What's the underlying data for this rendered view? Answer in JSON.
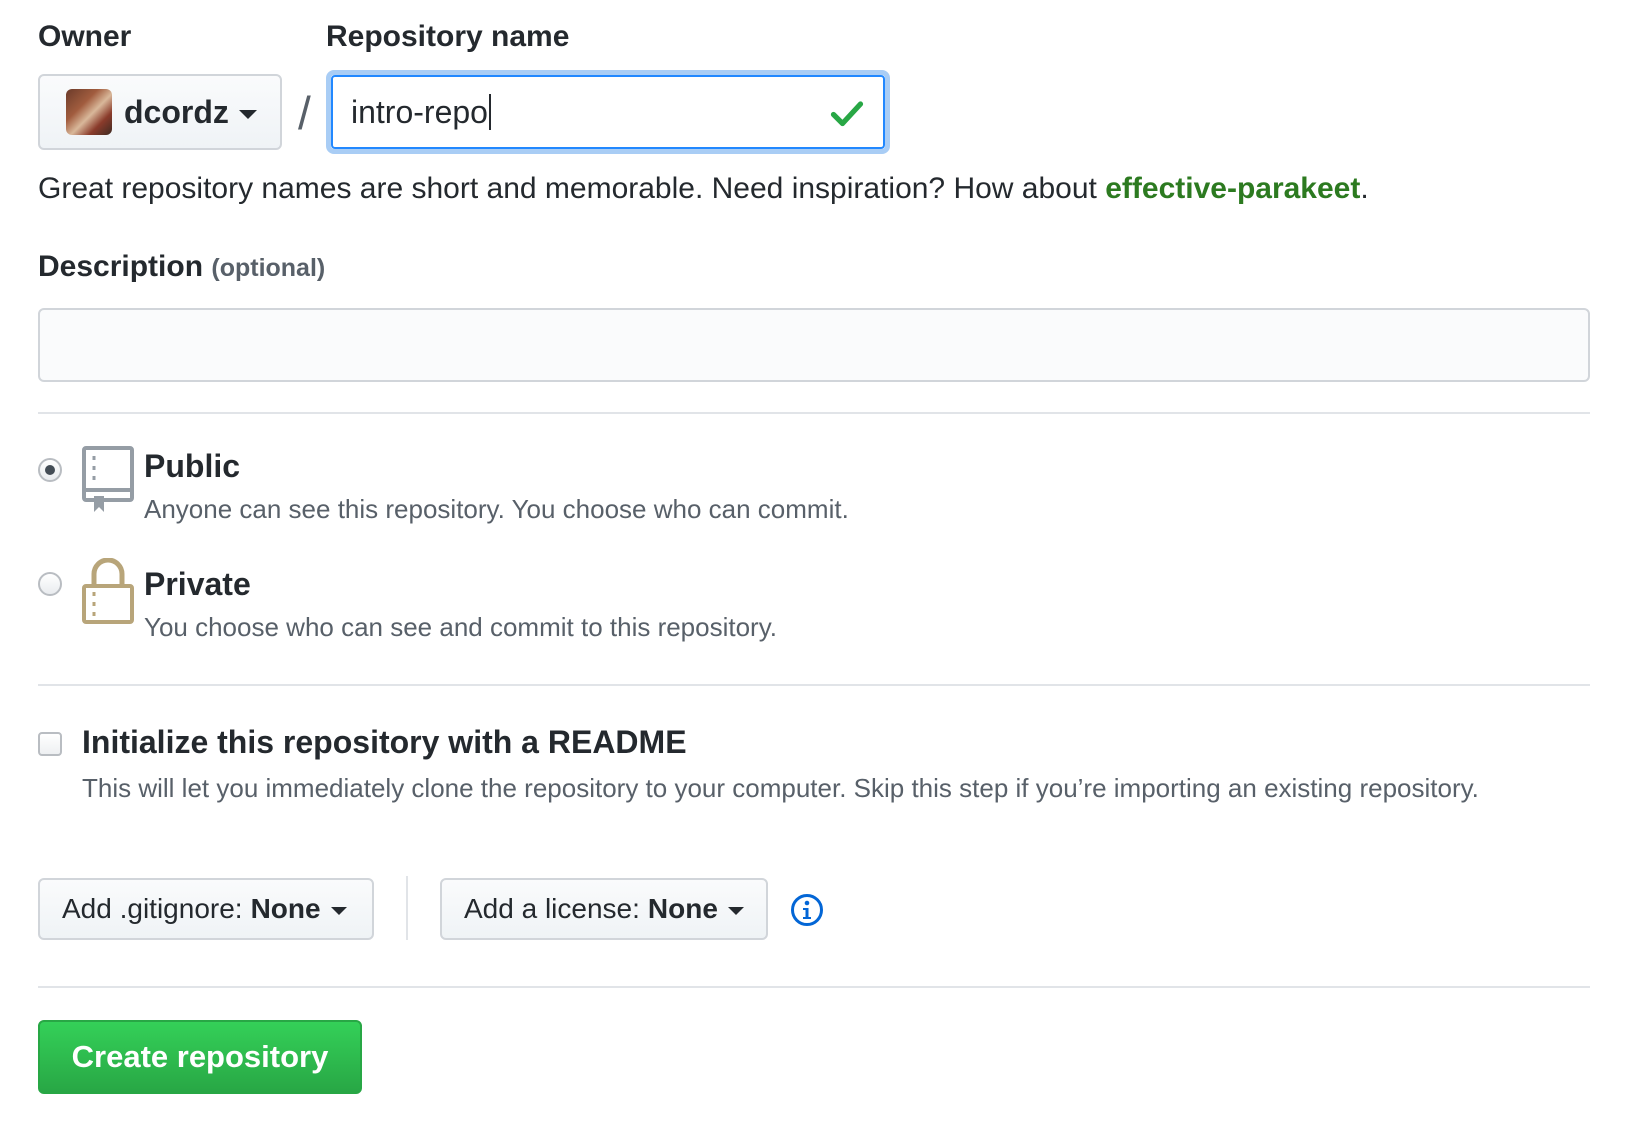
{
  "owner": {
    "label": "Owner",
    "selected": "dcordz"
  },
  "separator": "/",
  "repo_name": {
    "label": "Repository name",
    "value": "intro-repo",
    "status_icon": "check-icon"
  },
  "hint": {
    "text": "Great repository names are short and memorable. Need inspiration? How about ",
    "suggestion": "effective-parakeet",
    "end": "."
  },
  "description": {
    "label": "Description",
    "optional": "(optional)",
    "value": ""
  },
  "visibility": {
    "public": {
      "title": "Public",
      "desc": "Anyone can see this repository. You choose who can commit.",
      "icon": "repo-book-icon",
      "checked": true
    },
    "private": {
      "title": "Private",
      "desc": "You choose who can see and commit to this repository.",
      "icon": "lock-icon",
      "checked": false
    }
  },
  "readme": {
    "title": "Initialize this repository with a README",
    "desc": "This will let you immediately clone the repository to your computer. Skip this step if you’re importing an existing repository.",
    "checked": false
  },
  "gitignore": {
    "label": "Add .gitignore:",
    "value": "None"
  },
  "license": {
    "label": "Add a license:",
    "value": "None"
  },
  "create_button": "Create repository",
  "colors": {
    "accent_blue": "#2188ff",
    "success_green": "#28a745",
    "suggestion_green": "#2c7a20",
    "lock_gold": "#b8a57a"
  }
}
